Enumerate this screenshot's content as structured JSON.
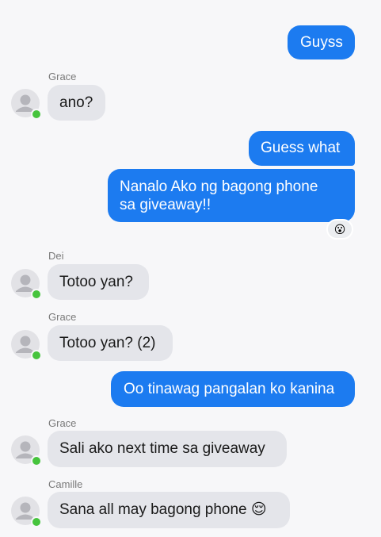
{
  "colors": {
    "outgoing_bubble": "#1c7bf0",
    "incoming_bubble": "#e4e5ea",
    "online_dot": "#46c43d",
    "background": "#f7f7f9"
  },
  "messages": [
    {
      "direction": "out",
      "text": "Guyss"
    },
    {
      "direction": "in",
      "sender": "Grace",
      "text": "ano?"
    },
    {
      "direction": "out",
      "text": "Guess what"
    },
    {
      "direction": "out",
      "text_lines": [
        "Nanalo Ako ng bagong phone",
        "sa giveaway!!"
      ],
      "reaction": "😮"
    },
    {
      "direction": "in",
      "sender": "Dei",
      "text": "Totoo yan?"
    },
    {
      "direction": "in",
      "sender": "Grace",
      "text": "Totoo yan? (2)"
    },
    {
      "direction": "out",
      "text": "Oo tinawag pangalan ko kanina"
    },
    {
      "direction": "in",
      "sender": "Grace",
      "text": "Sali ako next time sa giveaway"
    },
    {
      "direction": "in",
      "sender": "Camille",
      "text": "Sana all may bagong phone 😌"
    }
  ]
}
